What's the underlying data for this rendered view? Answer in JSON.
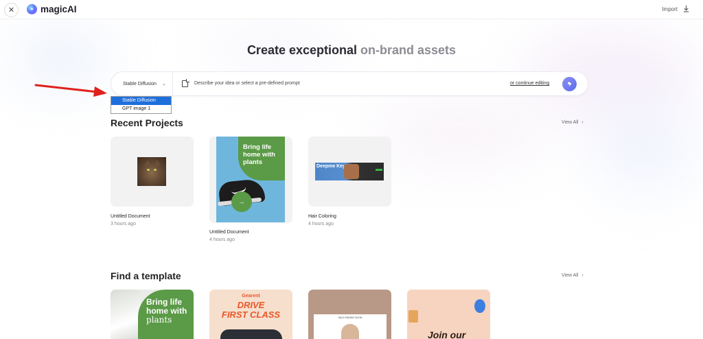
{
  "app": {
    "name": "magicAI"
  },
  "topbar": {
    "import_label": "Import"
  },
  "hero": {
    "title_main": "Create exceptional ",
    "title_muted": "on-brand assets"
  },
  "prompt": {
    "model_selected": "Stable Diffusion",
    "placeholder": "Describe your idea or select a pre-defined prompt",
    "continue_label": "or continue editing"
  },
  "model_dropdown": {
    "options": [
      "Stable Diffusion",
      "GPT image 1"
    ],
    "selected_index": 0
  },
  "recent_projects": {
    "title": "Recent Projects",
    "view_all": "View All",
    "items": [
      {
        "title": "Untitled Document",
        "time": "3 hours ago"
      },
      {
        "title": "Untitled Document",
        "time": "4 hours ago",
        "thumb_text": "Bring life home with plants"
      },
      {
        "title": "Hair Coloring",
        "time": "4 hours ago",
        "thumb_text": "Deepme Keynote"
      }
    ]
  },
  "templates": {
    "title": "Find a template",
    "view_all": "View All",
    "items": [
      {
        "line1": "Bring life",
        "line2": "home with",
        "line3": "plants"
      },
      {
        "brand": "Gearent",
        "line1": "DRIVE",
        "line2": "FIRST CLASS"
      },
      {
        "header": "SALE ENDING SOON"
      },
      {
        "text": "Join our"
      }
    ]
  },
  "colors": {
    "accent": "#5b6de8",
    "selected": "#1f6fdb",
    "annotation_arrow": "#e0201b",
    "green": "#5b9a47"
  }
}
